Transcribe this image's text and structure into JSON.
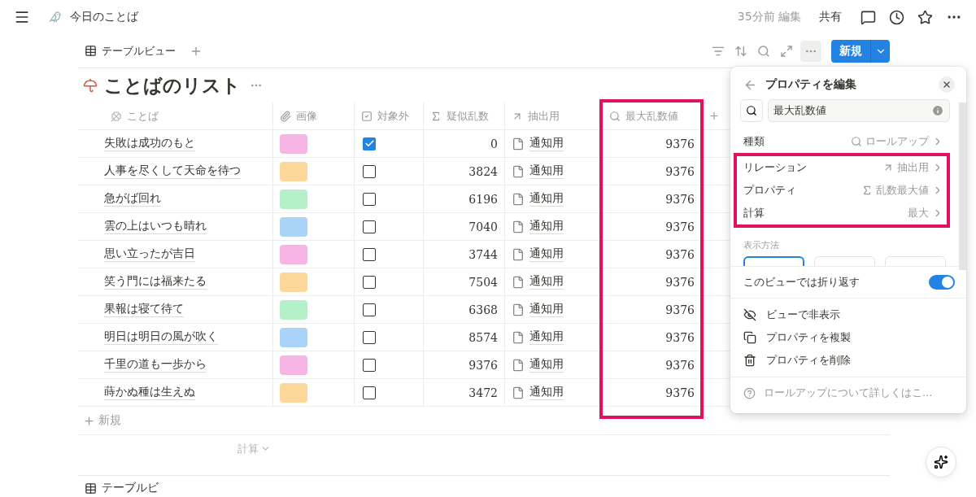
{
  "topbar": {
    "page_title": "今日のことば",
    "edited": "35分前 編集",
    "share": "共有"
  },
  "view_tabs": [
    {
      "label": "テーブルビュー",
      "selected": true
    }
  ],
  "toolbar": {
    "new_button": "新規"
  },
  "database_title": "ことばのリスト",
  "columns": [
    {
      "kind": "title",
      "label": "ことば",
      "highlighted": false
    },
    {
      "kind": "files",
      "label": "画像",
      "highlighted": false
    },
    {
      "kind": "checkbox",
      "label": "対象外",
      "highlighted": false
    },
    {
      "kind": "formula",
      "label": "疑似乱数",
      "highlighted": false
    },
    {
      "kind": "relation",
      "label": "抽出用",
      "highlighted": false
    },
    {
      "kind": "rollup",
      "label": "最大乱数値",
      "highlighted": true
    }
  ],
  "rows": [
    {
      "name": "失敗は成功のもと",
      "color": "#f7b5e6",
      "excluded": true,
      "random": "0",
      "relation": "通知用",
      "max": "9376"
    },
    {
      "name": "人事を尽くして天命を待つ",
      "color": "#fbd89a",
      "excluded": false,
      "random": "3824",
      "relation": "通知用",
      "max": "9376"
    },
    {
      "name": "急がば回れ",
      "color": "#b4f0c8",
      "excluded": false,
      "random": "6196",
      "relation": "通知用",
      "max": "9376"
    },
    {
      "name": "雲の上はいつも晴れ",
      "color": "#a9d4f7",
      "excluded": false,
      "random": "7040",
      "relation": "通知用",
      "max": "9376"
    },
    {
      "name": "思い立ったが吉日",
      "color": "#f7b5e6",
      "excluded": false,
      "random": "3744",
      "relation": "通知用",
      "max": "9376"
    },
    {
      "name": "笑う門には福来たる",
      "color": "#fbd89a",
      "excluded": false,
      "random": "7504",
      "relation": "通知用",
      "max": "9376"
    },
    {
      "name": "果報は寝て待て",
      "color": "#b4f0c8",
      "excluded": false,
      "random": "6368",
      "relation": "通知用",
      "max": "9376"
    },
    {
      "name": "明日は明日の風が吹く",
      "color": "#a9d4f7",
      "excluded": false,
      "random": "8574",
      "relation": "通知用",
      "max": "9376"
    },
    {
      "name": "千里の道も一歩から",
      "color": "#f7b5e6",
      "excluded": false,
      "random": "9376",
      "relation": "通知用",
      "max": "9376"
    },
    {
      "name": "蒔かぬ種は生えぬ",
      "color": "#fbd89a",
      "excluded": false,
      "random": "3472",
      "relation": "通知用",
      "max": "9376"
    }
  ],
  "new_row": "新規",
  "calculate": "計算",
  "bottom_view_label": "テーブルビ",
  "property_panel": {
    "title": "プロパティを編集",
    "name_value": "最大乱数値",
    "settings": [
      {
        "kind": "type",
        "label": "種類",
        "value": "ロールアップ",
        "highlighted": false
      },
      {
        "kind": "relation",
        "label": "リレーション",
        "value": "抽出用",
        "highlighted": true
      },
      {
        "kind": "property",
        "label": "プロパティ",
        "value": "乱数最大値",
        "highlighted": true
      },
      {
        "kind": "calc",
        "label": "計算",
        "value": "最大",
        "highlighted": true
      }
    ],
    "display_label": "表示方法",
    "display_options": [
      {
        "selected": true
      },
      {
        "selected": false
      },
      {
        "selected": false
      }
    ],
    "wrap_toggle": {
      "label": "このビューでは折り返す",
      "on": true
    },
    "actions": [
      {
        "kind": "hide",
        "label": "ビューで非表示"
      },
      {
        "kind": "duplicate",
        "label": "プロパティを複製"
      },
      {
        "kind": "delete",
        "label": "プロパティを削除"
      }
    ],
    "help": "ロールアップについて詳しくはこ..."
  }
}
